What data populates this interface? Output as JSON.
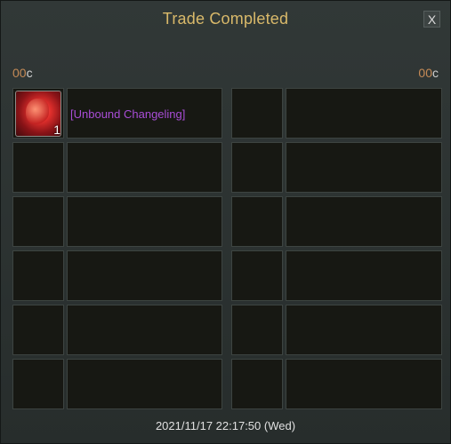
{
  "window": {
    "title": "Trade Completed",
    "close_label": "X"
  },
  "left": {
    "currency_amount": "00",
    "currency_unit": "c",
    "items": [
      {
        "name": "[Unbound Changeling]",
        "quantity": "1",
        "icon": "red-dragon-icon",
        "name_color": "#a84dd6"
      },
      {
        "name": "",
        "quantity": ""
      },
      {
        "name": "",
        "quantity": ""
      },
      {
        "name": "",
        "quantity": ""
      },
      {
        "name": "",
        "quantity": ""
      },
      {
        "name": "",
        "quantity": ""
      }
    ]
  },
  "right": {
    "currency_amount": "00",
    "currency_unit": "c",
    "items": [
      {
        "name": "",
        "quantity": ""
      },
      {
        "name": "",
        "quantity": ""
      },
      {
        "name": "",
        "quantity": ""
      },
      {
        "name": "",
        "quantity": ""
      },
      {
        "name": "",
        "quantity": ""
      },
      {
        "name": "",
        "quantity": ""
      }
    ]
  },
  "timestamp": "2021/11/17 22:17:50 (Wed)",
  "colors": {
    "title": "#d9b96a",
    "currency": "#c58a56",
    "item_rarity": "#a84dd6"
  }
}
